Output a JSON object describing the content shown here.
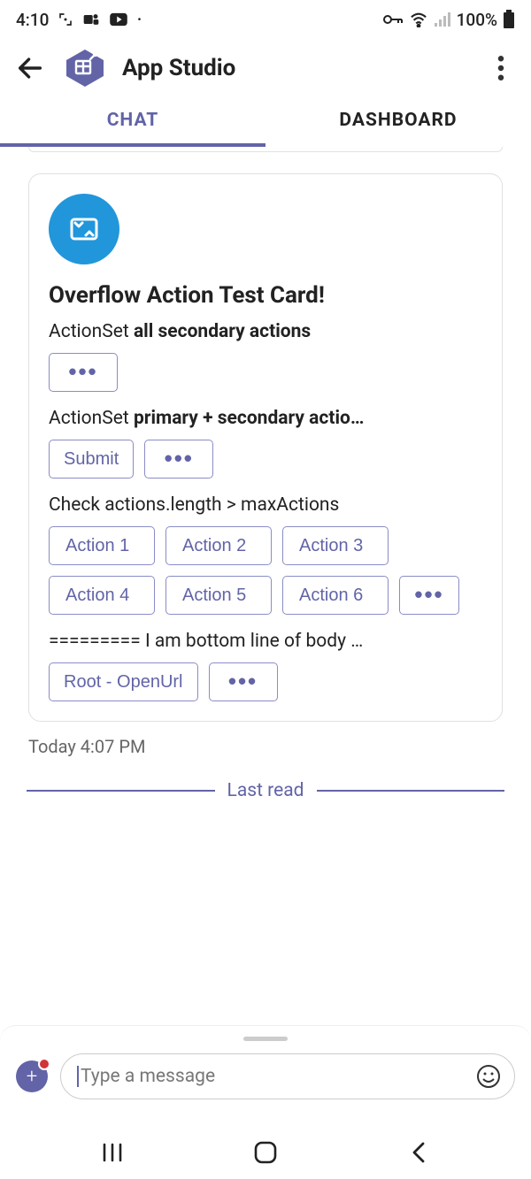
{
  "status": {
    "time": "4:10",
    "battery_text": "100%"
  },
  "header": {
    "title": "App Studio"
  },
  "tabs": [
    {
      "label": "CHAT",
      "active": true
    },
    {
      "label": "DASHBOARD",
      "active": false
    }
  ],
  "card": {
    "title": "Overflow Action Test Card!",
    "line1_prefix": "ActionSet ",
    "line1_bold": "all secondary actions",
    "line2_prefix": "ActionSet ",
    "line2_bold": "primary + secondary actio…",
    "submit_label": "Submit",
    "line3": "Check actions.length > maxActions",
    "grid_actions": [
      "Action 1",
      "Action 2",
      "Action 3",
      "Action 4",
      "Action 5",
      "Action 6"
    ],
    "bottom_text": "========= I am bottom line of body …",
    "root_action": "Root - OpenUrl",
    "overflow_glyph": "•••"
  },
  "timestamp": "Today 4:07 PM",
  "last_read": "Last read",
  "composer": {
    "placeholder": "ype a message"
  }
}
